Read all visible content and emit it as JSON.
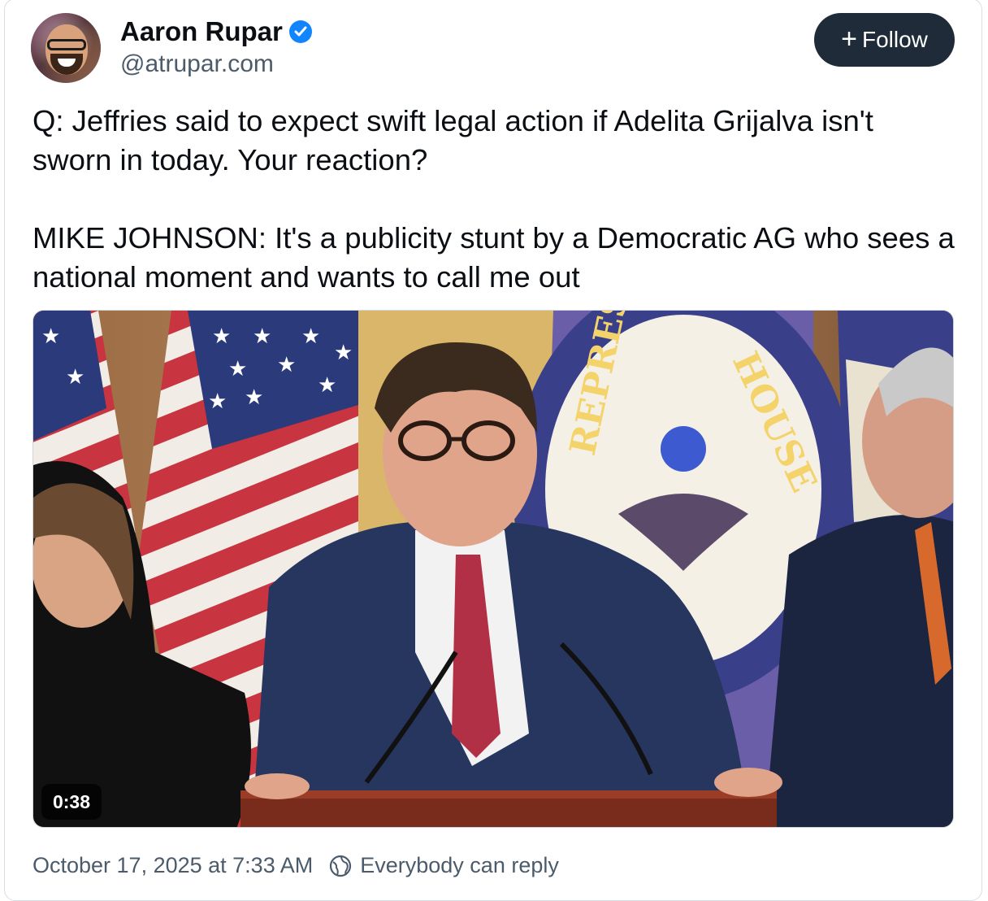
{
  "author": {
    "display_name": "Aaron Rupar",
    "handle": "@atrupar.com",
    "verified": true,
    "avatar_icon": "avatar-photo"
  },
  "follow_button": {
    "icon": "plus-icon",
    "label": "Follow"
  },
  "post": {
    "paragraphs": [
      "Q: Jeffries said to expect swift legal action if Adelita Grijalva isn't sworn in today. Your reaction?",
      "MIKE JOHNSON: It's a publicity stunt by a Democratic AG who sees a national moment and wants to call me out"
    ]
  },
  "video": {
    "duration": "0:38",
    "seal_text": "U.S. HOUSE OF REPRESENTATIVES"
  },
  "footer": {
    "timestamp": "October 17, 2025 at 7:33 AM",
    "reply_icon": "everybody-reply-icon",
    "reply_setting": "Everybody can reply"
  },
  "colors": {
    "follow_bg": "#1f2b38",
    "verified_badge": "#1185fe",
    "muted_text": "#4b5b6b"
  }
}
